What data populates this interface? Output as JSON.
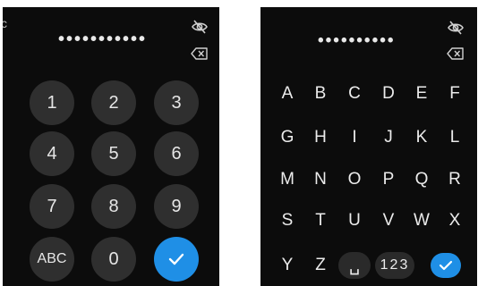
{
  "left_screen": {
    "pin_mask": "•••••••••••",
    "cut_glyph": "c",
    "icons": {
      "toggle_visibility": "eye-slash-icon",
      "backspace": "backspace-icon"
    },
    "keys": [
      "1",
      "2",
      "3",
      "4",
      "5",
      "6",
      "7",
      "8",
      "9",
      "ABC",
      "0"
    ],
    "confirm_icon": "checkmark-icon"
  },
  "right_screen": {
    "pin_mask": "••••••••••",
    "icons": {
      "toggle_visibility": "eye-slash-icon",
      "backspace": "backspace-icon"
    },
    "rows": [
      [
        "A",
        "B",
        "C",
        "D",
        "E",
        "F"
      ],
      [
        "G",
        "H",
        "I",
        "J",
        "K",
        "L"
      ],
      [
        "M",
        "N",
        "O",
        "P",
        "Q",
        "R"
      ],
      [
        "S",
        "T",
        "U",
        "V",
        "W",
        "X"
      ]
    ],
    "bottom_row": {
      "y": "Y",
      "z": "Z",
      "space": "␣",
      "numbers": "123"
    },
    "confirm_icon": "checkmark-icon"
  },
  "colors": {
    "background": "#0c0c0c",
    "key": "#2f2f2f",
    "accent": "#1f8fe6",
    "text": "#e6e6e6"
  }
}
